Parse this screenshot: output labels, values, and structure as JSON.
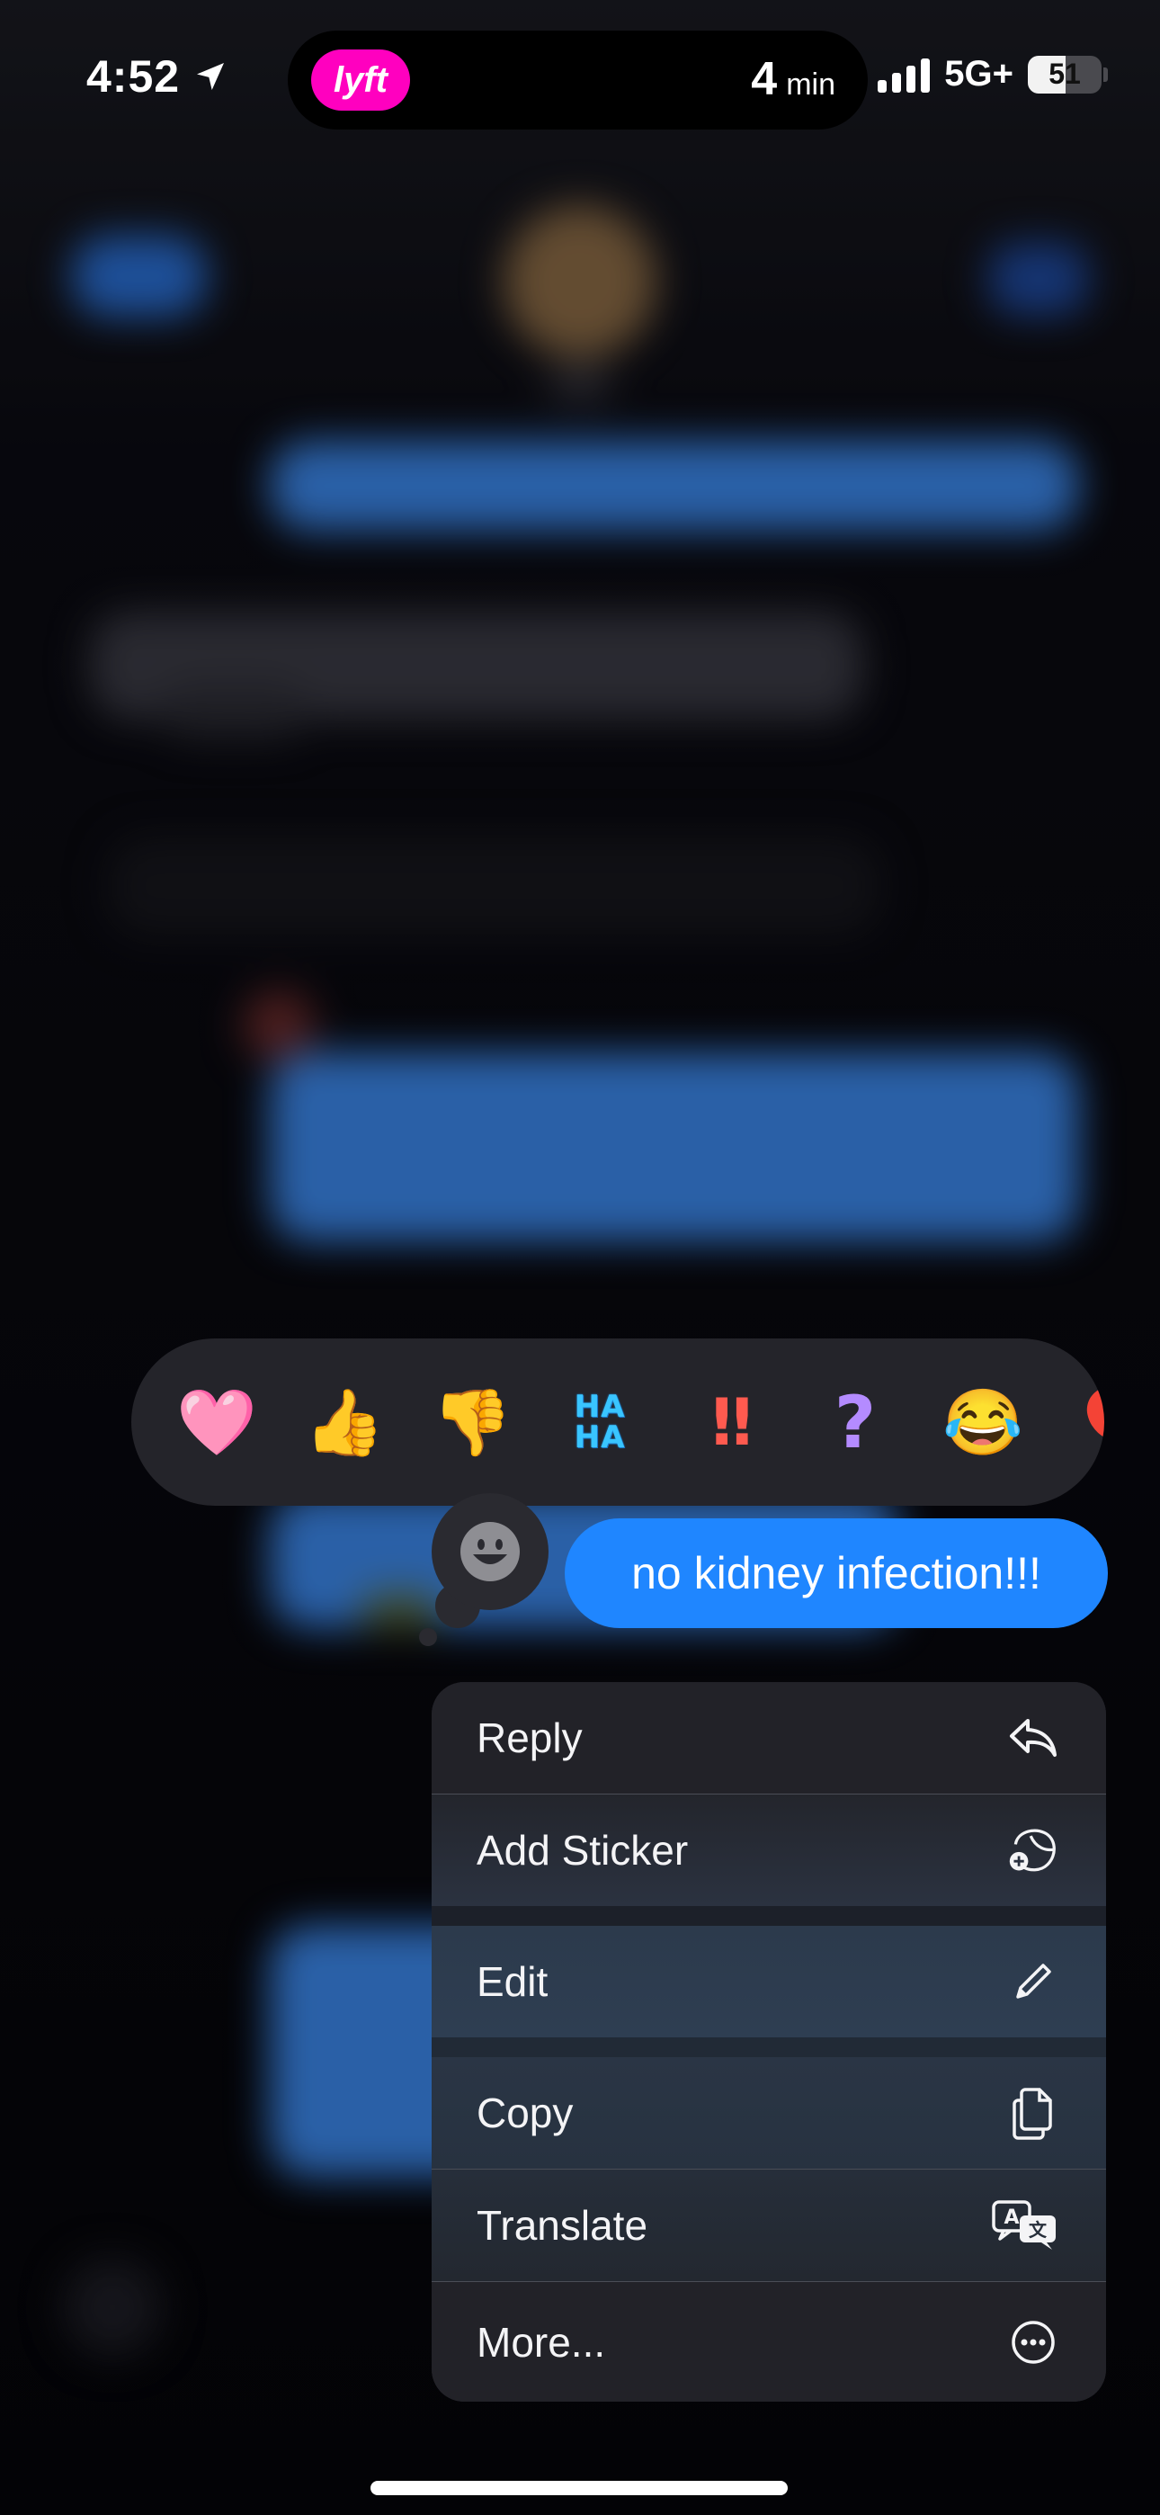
{
  "status_bar": {
    "time": "4:52",
    "live_activity": {
      "app_logo_text": "lyft",
      "eta_value": "4",
      "eta_unit": "min"
    },
    "network": "5G+",
    "battery_percent": "51",
    "signal_bars": 4
  },
  "tapbacks": [
    {
      "name": "heart",
      "glyph": "🩷"
    },
    {
      "name": "thumbs-up",
      "glyph": "👍"
    },
    {
      "name": "thumbs-down",
      "glyph": "👎"
    },
    {
      "name": "haha",
      "glyph": "HA\nHA"
    },
    {
      "name": "exclamation",
      "glyph": "‼"
    },
    {
      "name": "question",
      "glyph": "?"
    },
    {
      "name": "tears-of-joy",
      "glyph": "😂"
    },
    {
      "name": "more-emoji",
      "glyph": "🎈"
    }
  ],
  "message": {
    "text": "no kidney infection!!!",
    "bubble_color": "#1f86ff"
  },
  "context_menu": {
    "items": [
      {
        "label": "Reply",
        "icon": "reply-arrow-icon"
      },
      {
        "label": "Add Sticker",
        "icon": "add-sticker-icon"
      },
      {
        "label": "Edit",
        "icon": "pencil-icon"
      },
      {
        "label": "Copy",
        "icon": "copy-icon"
      },
      {
        "label": "Translate",
        "icon": "translate-icon"
      },
      {
        "label": "More...",
        "icon": "ellipsis-circle-icon"
      }
    ]
  },
  "colors": {
    "lyft_pink": "#ff00bf",
    "imessage_blue": "#1f86ff",
    "menu_bg": "#222228"
  }
}
